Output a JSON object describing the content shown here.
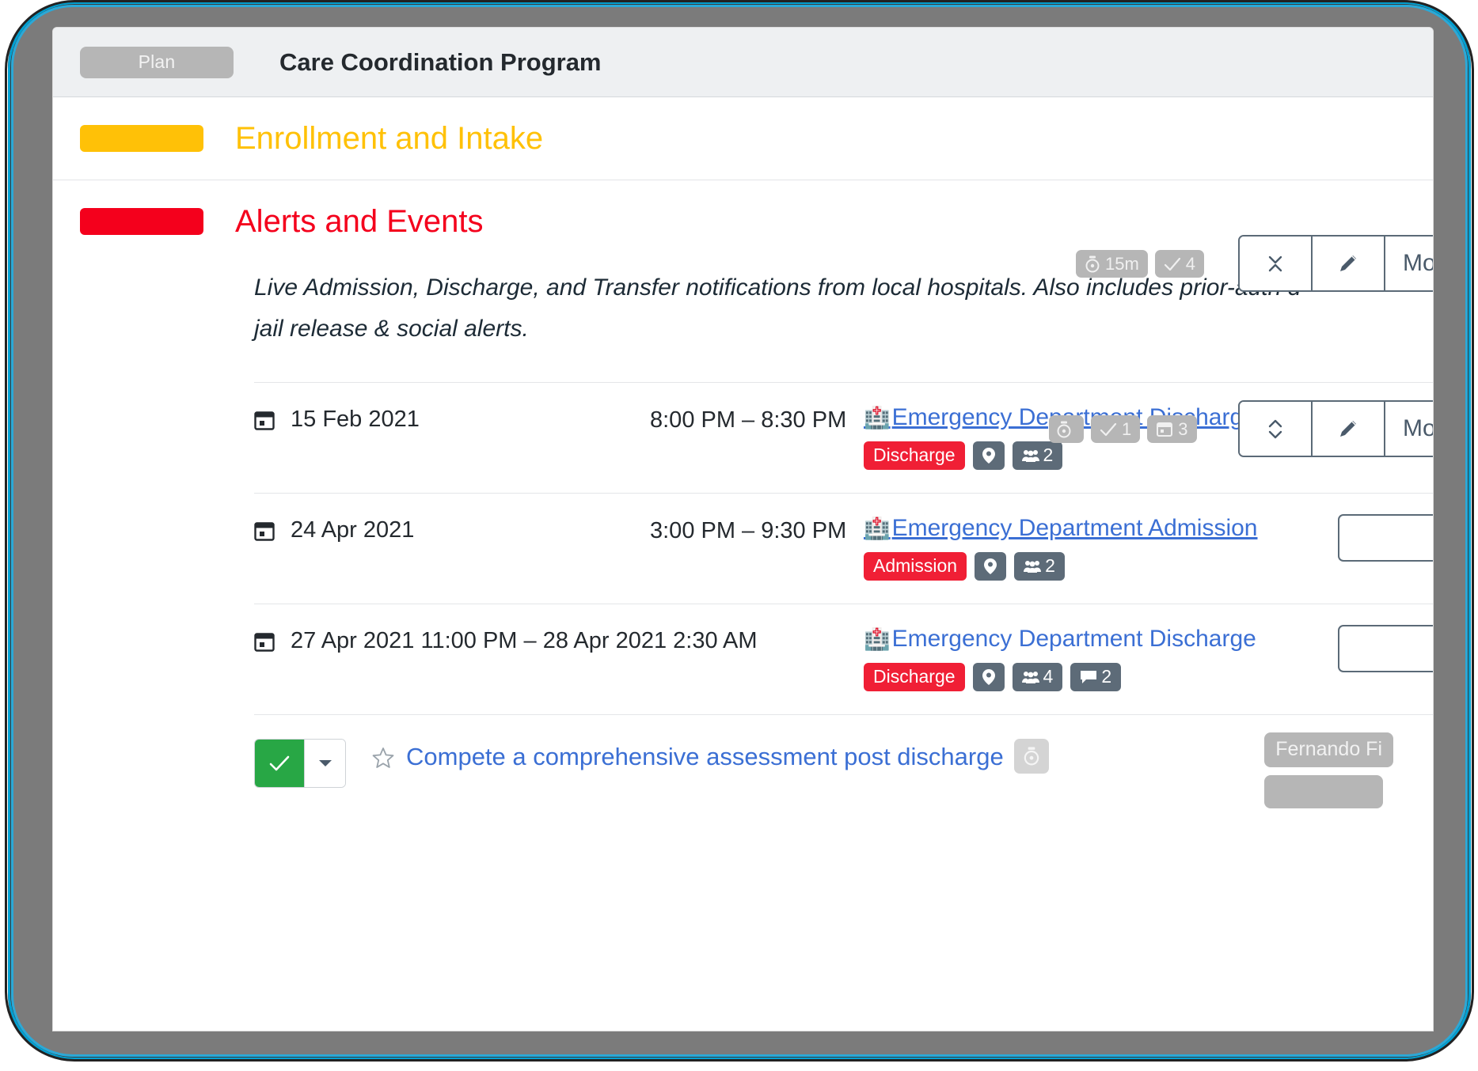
{
  "header": {
    "chip_label": "Plan",
    "title": "Care Coordination Program"
  },
  "sections": [
    {
      "name": "enrollment-and-intake",
      "title": "Enrollment and Intake",
      "color": "#FFC107",
      "title_color": "#FFC107",
      "badges": [
        {
          "icon": "timer-icon",
          "value": "15m"
        },
        {
          "icon": "check-icon",
          "value": "4"
        }
      ],
      "buttons": {
        "collapse_icon": "collapse-chevrons-icon",
        "edit_icon": "pencil-icon",
        "more_label": "More"
      }
    },
    {
      "name": "alerts-and-events",
      "title": "Alerts and Events",
      "color": "#F4001C",
      "title_color": "#F4001C",
      "badges": [
        {
          "icon": "timer-icon",
          "value": ""
        },
        {
          "icon": "check-icon",
          "value": "1"
        },
        {
          "icon": "calendar-icon",
          "value": "3"
        }
      ],
      "buttons": {
        "collapse_icon": "expand-chevrons-icon",
        "edit_icon": "pencil-icon",
        "more_label": "More"
      },
      "description_line1": "Live Admission, Discharge, and Transfer notifications from local hospitals. Also includes prior-auth d",
      "description_line2": "jail release & social alerts."
    }
  ],
  "events": [
    {
      "date": "15 Feb 2021",
      "time": "8:00 PM – 8:30 PM",
      "link": "Emergency Department Discharge",
      "link_underlined": true,
      "hospital_icon": "hospital-icon",
      "tags": {
        "type": "Discharge",
        "type_color": "#F01F35",
        "location_icon": "map-pin-icon",
        "people_icon": "people-icon",
        "people_count": "2",
        "comment_icon": "",
        "comment_count": ""
      }
    },
    {
      "date": "24 Apr 2021",
      "time": "3:00 PM – 9:30 PM",
      "link": "Emergency Department Admission",
      "link_underlined": true,
      "hospital_icon": "hospital-icon",
      "tags": {
        "type": "Admission",
        "type_color": "#F01F35",
        "location_icon": "map-pin-icon",
        "people_icon": "people-icon",
        "people_count": "2",
        "comment_icon": "",
        "comment_count": ""
      }
    },
    {
      "date": "27 Apr 2021 11:00 PM – 28 Apr 2021 2:30 AM",
      "time": "",
      "link": "Emergency Department Discharge",
      "link_underlined": false,
      "hospital_icon": "hospital-icon",
      "tags": {
        "type": "Discharge",
        "type_color": "#F01F35",
        "location_icon": "map-pin-icon",
        "people_icon": "people-icon",
        "people_count": "4",
        "comment_icon": "comment-icon",
        "comment_count": "2"
      }
    }
  ],
  "task": {
    "status_icon": "check-icon",
    "dropdown_icon": "caret-down-icon",
    "star_icon": "star-outline-icon",
    "title": "Compete a comprehensive assessment post discharge",
    "timer_icon": "timer-icon",
    "owner": "Fernando Fi"
  }
}
